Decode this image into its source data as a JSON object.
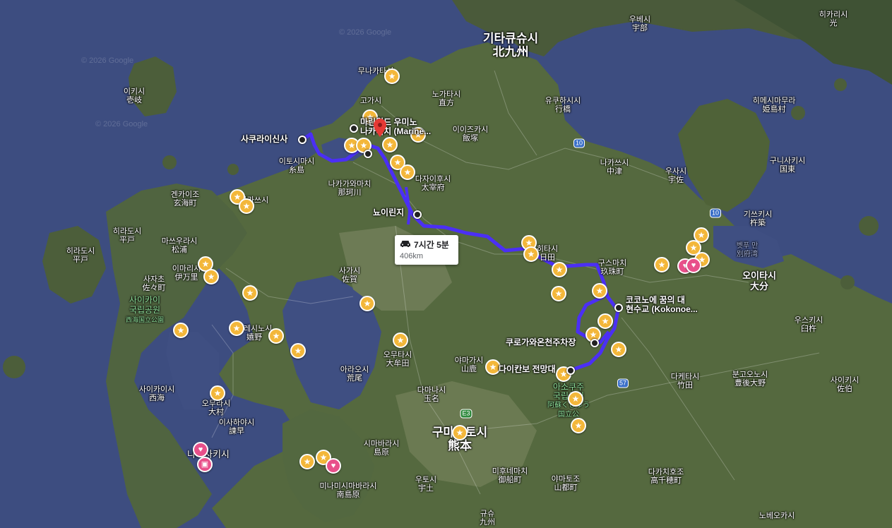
{
  "labels": {
    "kitakyushu_ko": "기타큐슈시",
    "kitakyushu_ja": "北九州",
    "kumamoto_ko": "구마모토시",
    "kumamoto_ja": "熊本",
    "oita_ko": "오이타시",
    "oita_ja": "大分",
    "iki_ko": "이키시",
    "iki_ja": "壱岐",
    "munakata_ko": "무나카타시",
    "koga_ko": "고가시",
    "nogata_ko": "노가타시",
    "nogata_ja": "直方",
    "yukuhashi_ko": "유쿠하시시",
    "yukuhashi_ja": "行橋",
    "usa_ko": "우사시",
    "usa_ja": "宇佐",
    "nakatsu_ko": "나카쓰시",
    "nakatsu_ja": "中津",
    "iizuka_ko": "이이즈카시",
    "iizuka_ja": "飯塚",
    "dazaifu_ko": "다자이후시",
    "dazaifu_ja": "太宰府",
    "nakagawa_ko": "나카가와마치",
    "nakagawa_ja": "那珂川",
    "itoshima_ko": "이토시마시",
    "itoshima_ja": "糸島",
    "genkai_ko": "겐카이조",
    "genkai_ja": "玄海町",
    "karatsu_ko": "가라쓰시",
    "karatsu_ja": "唐津",
    "hirado_ko": "히라도시",
    "hirado_ja": "平戸",
    "matsuura_ko": "마쓰우라시",
    "matsuura_ja": "松浦",
    "imari_ko": "이마리시",
    "imari_ja": "伊万里",
    "sasa_ko": "사자초",
    "sasa_ja": "佐々町",
    "saga_ko": "사가시",
    "saga_ja": "佐賀",
    "ureshino_ko": "우레시노시",
    "ureshino_ja": "嬉野",
    "saikai_park_ko": "사이카이",
    "saikai_park_ko2": "국립공원",
    "saikai_park_ja": "西海国立公園",
    "saikai_ko": "사이카이시",
    "saikai_ja": "西海",
    "omura_ko": "오무라시",
    "omura_ja": "大村",
    "isahaya_ko": "이사하야시",
    "isahaya_ja": "諫早",
    "nagasaki_ko": "나가사키시",
    "shimabara_ko": "시마바라시",
    "shimabara_ja": "島原",
    "minamishimabara_ko": "미나미시마바라시",
    "minamishimabara_ja": "南島原",
    "omuta_ko": "오무타시",
    "omuta_ja": "大牟田",
    "arao_ko": "아라오시",
    "arao_ja": "荒尾",
    "yamaga_ko": "야마가시",
    "yamaga_ja": "山鹿",
    "tamana_ko": "다마나시",
    "tamana_ja": "玉名",
    "uto_ko": "우토시",
    "uto_ja": "宇土",
    "misato_ko": "미후네마치",
    "misato_ja": "御船町",
    "yamato_ko": "야마토조",
    "yamato_ja": "山都町",
    "takachiho_ko": "다카치호조",
    "takachiho_ja": "高千穂町",
    "taketa_ko": "다케타시",
    "taketa_ja": "竹田",
    "bungoono_ko": "분고오노시",
    "bungoono_ja": "豊後大野",
    "saiki_ko": "사이키시",
    "saiki_ja": "佐伯",
    "usuki_ko": "우스키시",
    "usuki_ja": "臼杵",
    "kitsuki_ko": "기쓰키시",
    "kitsuki_ja": "杵築",
    "kunisaki_ko": "구니사키시",
    "kunisaki_ja": "国東",
    "himeshima_ko": "히메시마무라",
    "himeshima_ja": "姫島村",
    "ube_ko": "우베시",
    "ube_ja": "宇部",
    "hikari_ko": "히카리시",
    "hikari_ja": "光",
    "kusu_ko": "구스마치",
    "kusu_ja": "玖珠町",
    "hita_ko": "히타시",
    "hita_ja": "日田",
    "beppu_bay_ko": "벳푸 만",
    "beppu_bay_ja": "別府湾",
    "aso_ko": "아소쿠주",
    "aso_ko2": "국립공원",
    "aso_ja": "阿蘇くじゅう",
    "aso_ja2": "国立公",
    "kyushu_ko": "규슈",
    "kyushu_ja": "九州",
    "nobeoka_ko": "노베오카시",
    "hirado_sea_ko": "히라도시",
    "watermark": "© 2026 Google"
  },
  "places": {
    "sakurai": "사쿠라이신사",
    "marine_world": "마린월드 우미노",
    "marine_world2": "나카미치 (Marine...",
    "nuiriji": "뇨이린지",
    "kokonoe": "코코노에 꿈의 대",
    "kokonoe2": "현수교 (Kokonoe...",
    "kurokawa": "쿠로가와온천주차장",
    "daikanbo": "다이칸보 전망대"
  },
  "route_info": {
    "duration": "7시간 5분",
    "distance": "406km"
  },
  "roads": {
    "r10a": "10",
    "r10b": "10",
    "r57": "57",
    "e3": "E3"
  },
  "colors": {
    "route": "#4b2ff5",
    "star": "#f3b73a",
    "heart": "#e8508a",
    "pin": "#e53935"
  },
  "icons": {
    "car": "car-icon",
    "pin": "map-pin-icon",
    "star": "star-marker-icon",
    "heart": "heart-marker-icon"
  }
}
